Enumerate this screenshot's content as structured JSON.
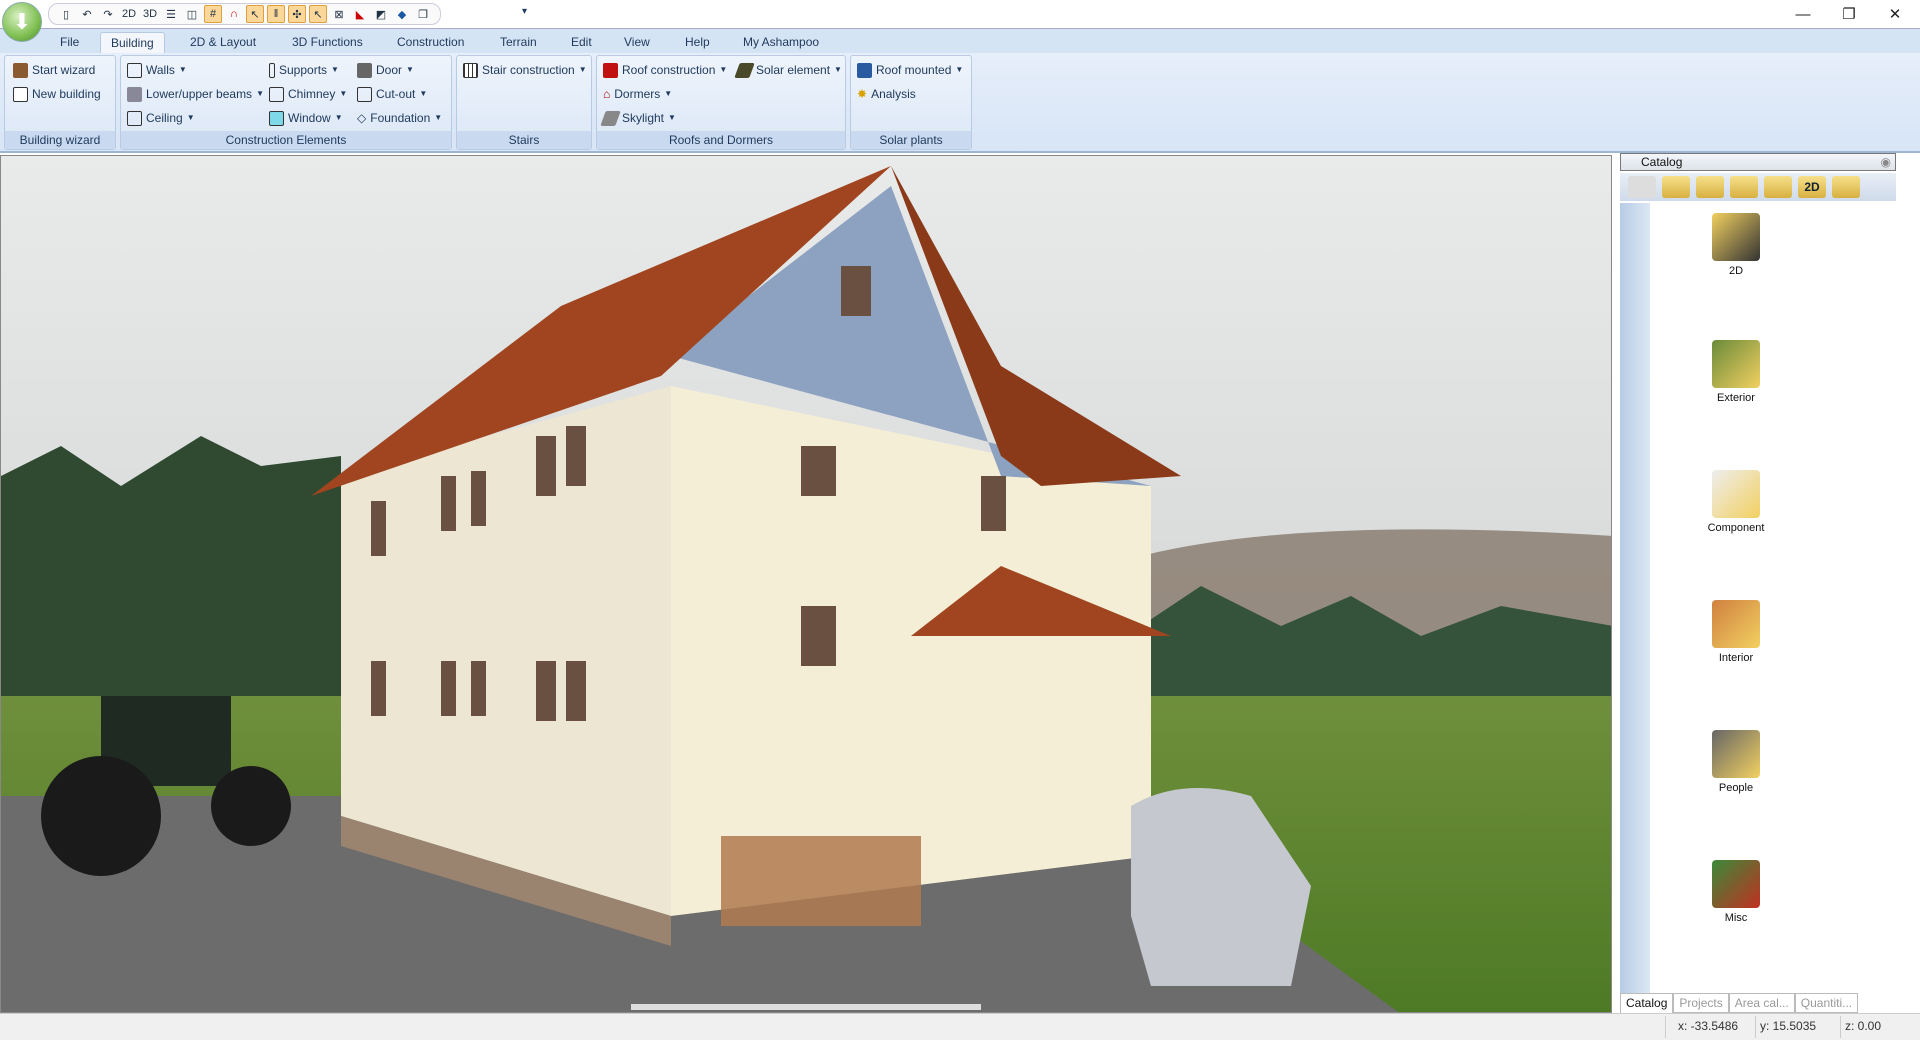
{
  "quick_access": {
    "icons": [
      "new-file",
      "undo",
      "redo",
      "2d-view",
      "3d-view",
      "horizontal-split",
      "vertical-split",
      "grid",
      "magnet",
      "select-arrow",
      "parallel-lines",
      "snap",
      "pointer",
      "window-frame",
      "roof",
      "stairs",
      "blue-element",
      "copy",
      "customize"
    ],
    "labels": {
      "2d": "2D",
      "3d": "3D"
    }
  },
  "window_controls": {
    "minimize": "—",
    "restore": "❐",
    "close": "✕"
  },
  "tabs": [
    "File",
    "Building",
    "2D & Layout",
    "3D Functions",
    "Construction",
    "Terrain",
    "Edit",
    "View",
    "Help",
    "My Ashampoo"
  ],
  "active_tab": "Building",
  "ribbon": {
    "building_wizard": {
      "label": "Building wizard",
      "items": [
        "Start wizard",
        "New building"
      ]
    },
    "construction_elements": {
      "label": "Construction Elements",
      "items": [
        "Walls",
        "Lower/upper beams",
        "Ceiling",
        "Supports",
        "Chimney",
        "Window",
        "Door",
        "Cut-out",
        "Foundation"
      ]
    },
    "stairs": {
      "label": "Stairs",
      "items": [
        "Stair construction"
      ]
    },
    "roofs": {
      "label": "Roofs and Dormers",
      "items": [
        "Roof construction",
        "Dormers",
        "Skylight",
        "Solar element"
      ]
    },
    "solar": {
      "label": "Solar plants",
      "items": [
        "Roof mounted",
        "Analysis"
      ]
    }
  },
  "catalog": {
    "title": "Catalog",
    "toolbar_2d": "2D",
    "items": [
      "2D",
      "Exterior",
      "Component",
      "Interior",
      "People",
      "Misc"
    ],
    "tabs": [
      "Catalog",
      "Projects",
      "Area cal...",
      "Quantiti..."
    ]
  },
  "status": {
    "x": "x: -33.5486",
    "y": "y: 15.5035",
    "z": "z: 0.00"
  },
  "colors": {
    "ribbon": "#d7e5f6",
    "accent": "#1e395b",
    "roof": "#a0451f",
    "wall": "#f3ecd3"
  }
}
